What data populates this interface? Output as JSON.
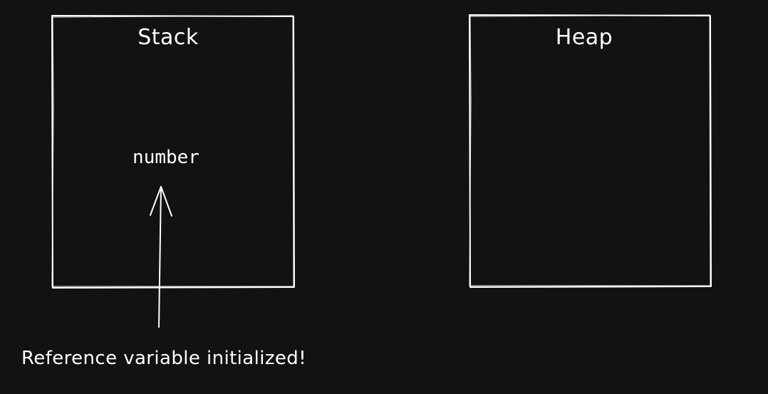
{
  "diagram": {
    "stack_title": "Stack",
    "heap_title": "Heap",
    "variable_name": "number",
    "caption": "Reference variable initialized!"
  },
  "colors": {
    "background": "#121212",
    "stroke": "#ffffff"
  }
}
